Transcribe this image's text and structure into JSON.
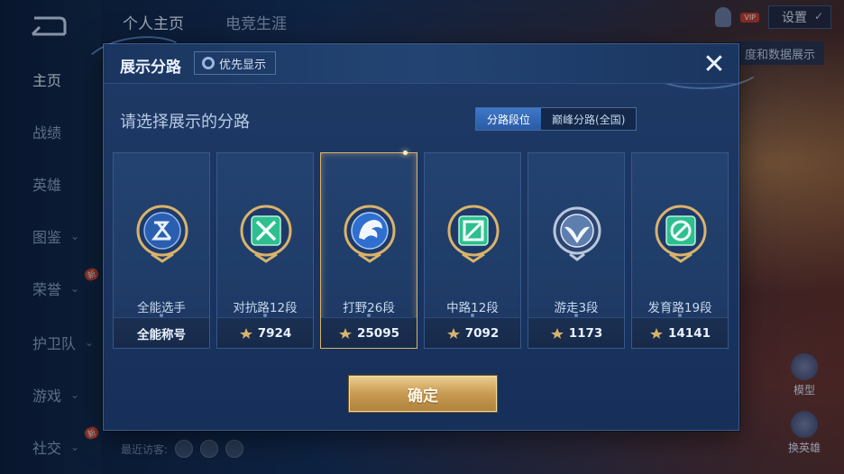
{
  "sidebar": {
    "items": [
      {
        "label": "主页",
        "active": true
      },
      {
        "label": "战绩"
      },
      {
        "label": "英雄"
      },
      {
        "label": "图鉴",
        "chevron": true
      },
      {
        "label": "荣誉",
        "chevron": true,
        "badge": "新"
      },
      {
        "label": "护卫队",
        "chevron": true
      },
      {
        "label": "游戏",
        "chevron": true
      },
      {
        "label": "社交",
        "chevron": true,
        "badge": "新"
      }
    ]
  },
  "top": {
    "tabs": [
      "个人主页",
      "电竞生涯"
    ],
    "settings_label": "设置",
    "vip_label": "VIP",
    "hint_text": "度和数据展示"
  },
  "right_buttons": {
    "model_label": "模型",
    "swap_hero_label": "换英雄"
  },
  "visitors_label": "最近访客:",
  "dialog": {
    "title": "展示分路",
    "priority_label": "优先显示",
    "close_symbol": "✕",
    "subtitle": "请选择展示的分路",
    "segments": [
      "分路段位",
      "巅峰分路(全国)"
    ],
    "active_segment": 0,
    "confirm_label": "确定",
    "cards": [
      {
        "name": "全能选手",
        "value": "全能称号",
        "icon": "all-round-emblem-icon",
        "has_star": false,
        "selected": false
      },
      {
        "name": "对抗路12段",
        "value": "7924",
        "icon": "clash-lane-emblem-icon",
        "has_star": true,
        "selected": false
      },
      {
        "name": "打野26段",
        "value": "25095",
        "icon": "jungle-emblem-icon",
        "has_star": true,
        "selected": true
      },
      {
        "name": "中路12段",
        "value": "7092",
        "icon": "mid-lane-emblem-icon",
        "has_star": true,
        "selected": false
      },
      {
        "name": "游走3段",
        "value": "1173",
        "icon": "roam-emblem-icon",
        "has_star": true,
        "selected": false
      },
      {
        "name": "发育路19段",
        "value": "14141",
        "icon": "farm-lane-emblem-icon",
        "has_star": true,
        "selected": false
      }
    ]
  },
  "colors": {
    "gold_accent": "#d9b36a",
    "active_segment": "#3e78c8",
    "emerald": "#2fbf8f",
    "jungle_blue": "#2f6fd0"
  }
}
